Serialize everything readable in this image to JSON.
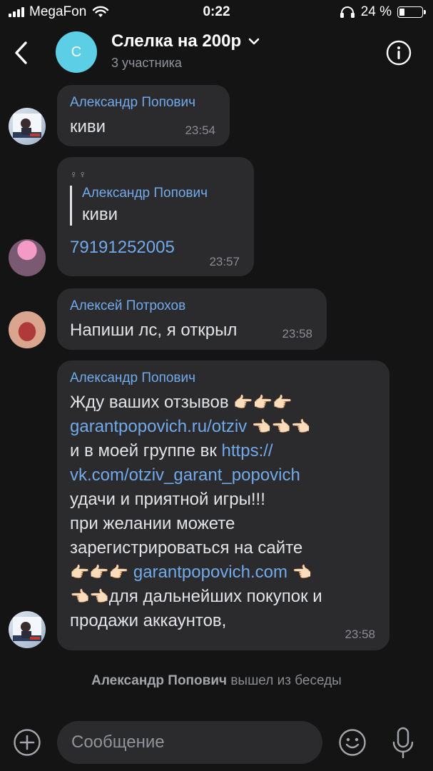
{
  "status": {
    "carrier": "MegaFon",
    "time": "0:22",
    "battery": "24 %",
    "battery_level": 0.24
  },
  "header": {
    "avatar_letter": "С",
    "title": "Слелка на 200р",
    "subtitle": "3 участника"
  },
  "messages": [
    {
      "sender": "Александр Попович",
      "text": "киви",
      "time": "23:54"
    },
    {
      "sticker": "♀♀",
      "reply_sender": "Александр Попович",
      "reply_text": "киви",
      "text": "79191252005",
      "time": "23:57"
    },
    {
      "sender": "Алексей Потрохов",
      "text": "Напиши лс, я открыл",
      "time": "23:58"
    },
    {
      "sender": "Александр Попович",
      "line1": "Жду ваших отзывов",
      "hands_right": "👉🏻👉🏻👉🏻",
      "link1": "garantpopovich.ru/otziv",
      "hands_point": "👈🏻👈🏻👈🏻",
      "line3": "и в моей группе вк",
      "link2a": "https://",
      "link2b": "vk.com/otziv_garant_popovich",
      "line5": "удачи и приятной игры!!!",
      "line6": "при желании можете",
      "line7": "зарегистрироваться на сайте",
      "link3": "garantpopovich.com",
      "hand_single": "👈🏻",
      "hands_two": "👈🏻👈🏻",
      "line9": "для дальнейших покупок и",
      "line10": "продажи аккаунтов,",
      "time": "23:58"
    }
  ],
  "system_message": {
    "name": "Александр Попович",
    "action": "вышел из беседы"
  },
  "composer": {
    "placeholder": "Сообщение"
  },
  "colors": {
    "background": "#141414",
    "bubble": "#2b2b2d",
    "accent": "#71aaeb",
    "chat_avatar": "#5ccfe6"
  },
  "icons": [
    "back-chevron-icon",
    "info-icon",
    "plus-icon",
    "emoji-icon",
    "microphone-icon",
    "wifi-icon",
    "headphones-icon",
    "battery-icon",
    "chevron-down-icon"
  ]
}
